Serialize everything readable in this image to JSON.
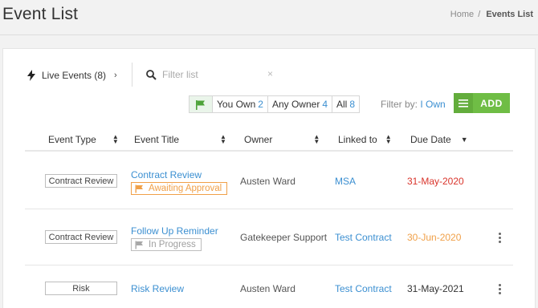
{
  "header": {
    "title": "Event List",
    "breadcrumb": {
      "home": "Home",
      "separator": "/",
      "current": "Events List"
    }
  },
  "toolbar": {
    "live_events_label": "Live Events (8)",
    "search_placeholder": "Filter list",
    "clear_glyph": "×",
    "filters": [
      {
        "label": "You Own",
        "count": "2"
      },
      {
        "label": "Any Owner",
        "count": "4"
      },
      {
        "label": "All",
        "count": "8"
      }
    ],
    "filter_by_label": "Filter by:",
    "filter_by_value": "I Own",
    "add_label": "ADD"
  },
  "table": {
    "columns": [
      "Event Type",
      "Event Title",
      "Owner",
      "Linked to",
      "Due Date"
    ],
    "rows": [
      {
        "type": "Contract Review",
        "title": "Contract Review",
        "status": "Awaiting Approval",
        "owner": "Austen Ward",
        "linked": "MSA",
        "due": "31-May-2020",
        "due_color": "#d9342b"
      },
      {
        "type": "Contract Review",
        "title": "Follow Up Reminder",
        "status": "In Progress",
        "owner": "Gatekeeper Support",
        "linked": "Test Contract",
        "due": "30-Jun-2020",
        "due_color": "#f0a048"
      },
      {
        "type": "Risk",
        "title": "Risk Review",
        "status": "",
        "owner": "Austen Ward",
        "linked": "Test Contract",
        "due": "31-May-2021",
        "due_color": "#333333"
      }
    ]
  },
  "colors": {
    "accent": "#3b8fd1",
    "add": "#6fbd45",
    "awaiting": "#f0a048",
    "overdue": "#d9342b"
  }
}
